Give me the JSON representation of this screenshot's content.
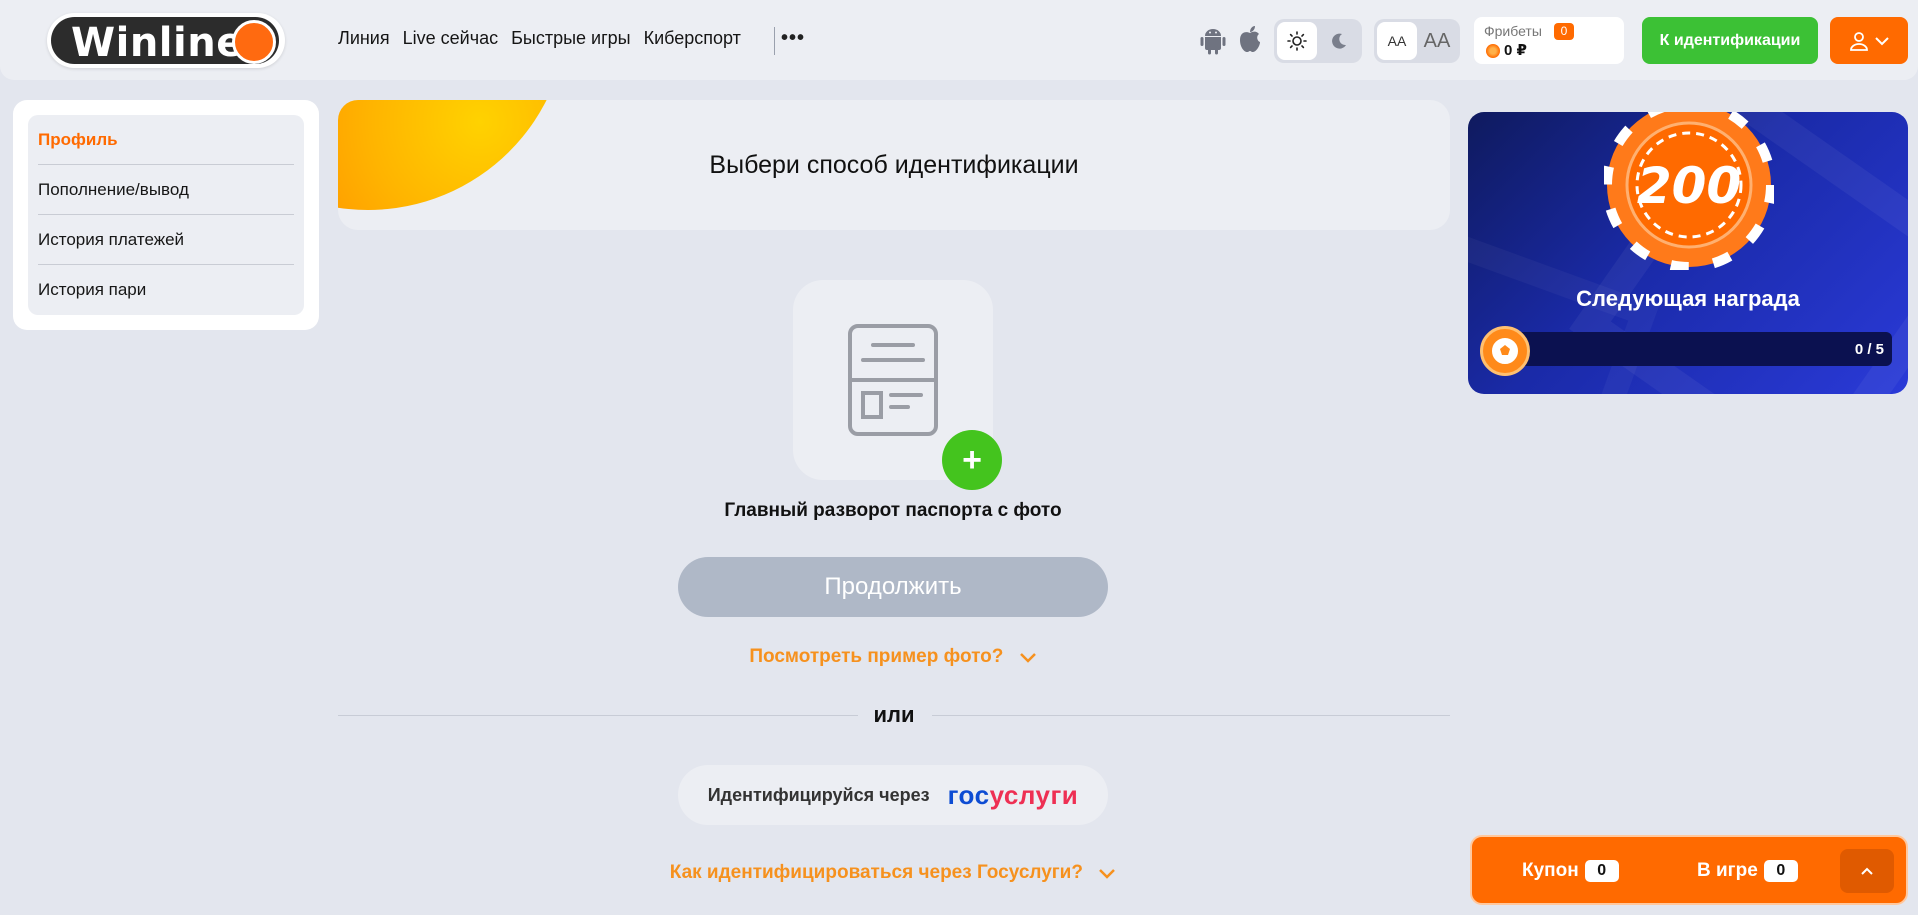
{
  "header": {
    "logo_text": "Winline",
    "nav": [
      "Линия",
      "Live сейчас",
      "Быстрые игры",
      "Киберспорт"
    ],
    "more_label": "•••",
    "font_small": "AA",
    "font_large": "AA",
    "freebets_label": "Фрибеты",
    "freebets_count": "0",
    "balance": "0 ₽",
    "ident_button": "К идентификации"
  },
  "sidebar": {
    "items": [
      {
        "label": "Профиль"
      },
      {
        "label": "Пополнение/вывод"
      },
      {
        "label": "История платежей"
      },
      {
        "label": "История пари"
      }
    ]
  },
  "main": {
    "title": "Выбери способ идентификации",
    "doc_label": "Главный разворот паспорта с фото",
    "continue_button": "Продолжить",
    "example_link": "Посмотреть пример фото?",
    "or_text": "или",
    "gos_label": "Идентифицируйся через",
    "gos_logo_part1": "гос",
    "gos_logo_part2": "услуги",
    "how_link": "Как идентифицироваться через Госуслуги?"
  },
  "reward": {
    "chip_value": "200",
    "title": "Следующая награда",
    "progress_text": "0 / 5",
    "progress_value": 0,
    "progress_max": 5
  },
  "coupon": {
    "coupon_label": "Купон",
    "coupon_count": "0",
    "ingame_label": "В игре",
    "ingame_count": "0"
  },
  "colors": {
    "accent_orange": "#ff6a00",
    "green": "#3cc135",
    "link_orange": "#f6911e"
  }
}
